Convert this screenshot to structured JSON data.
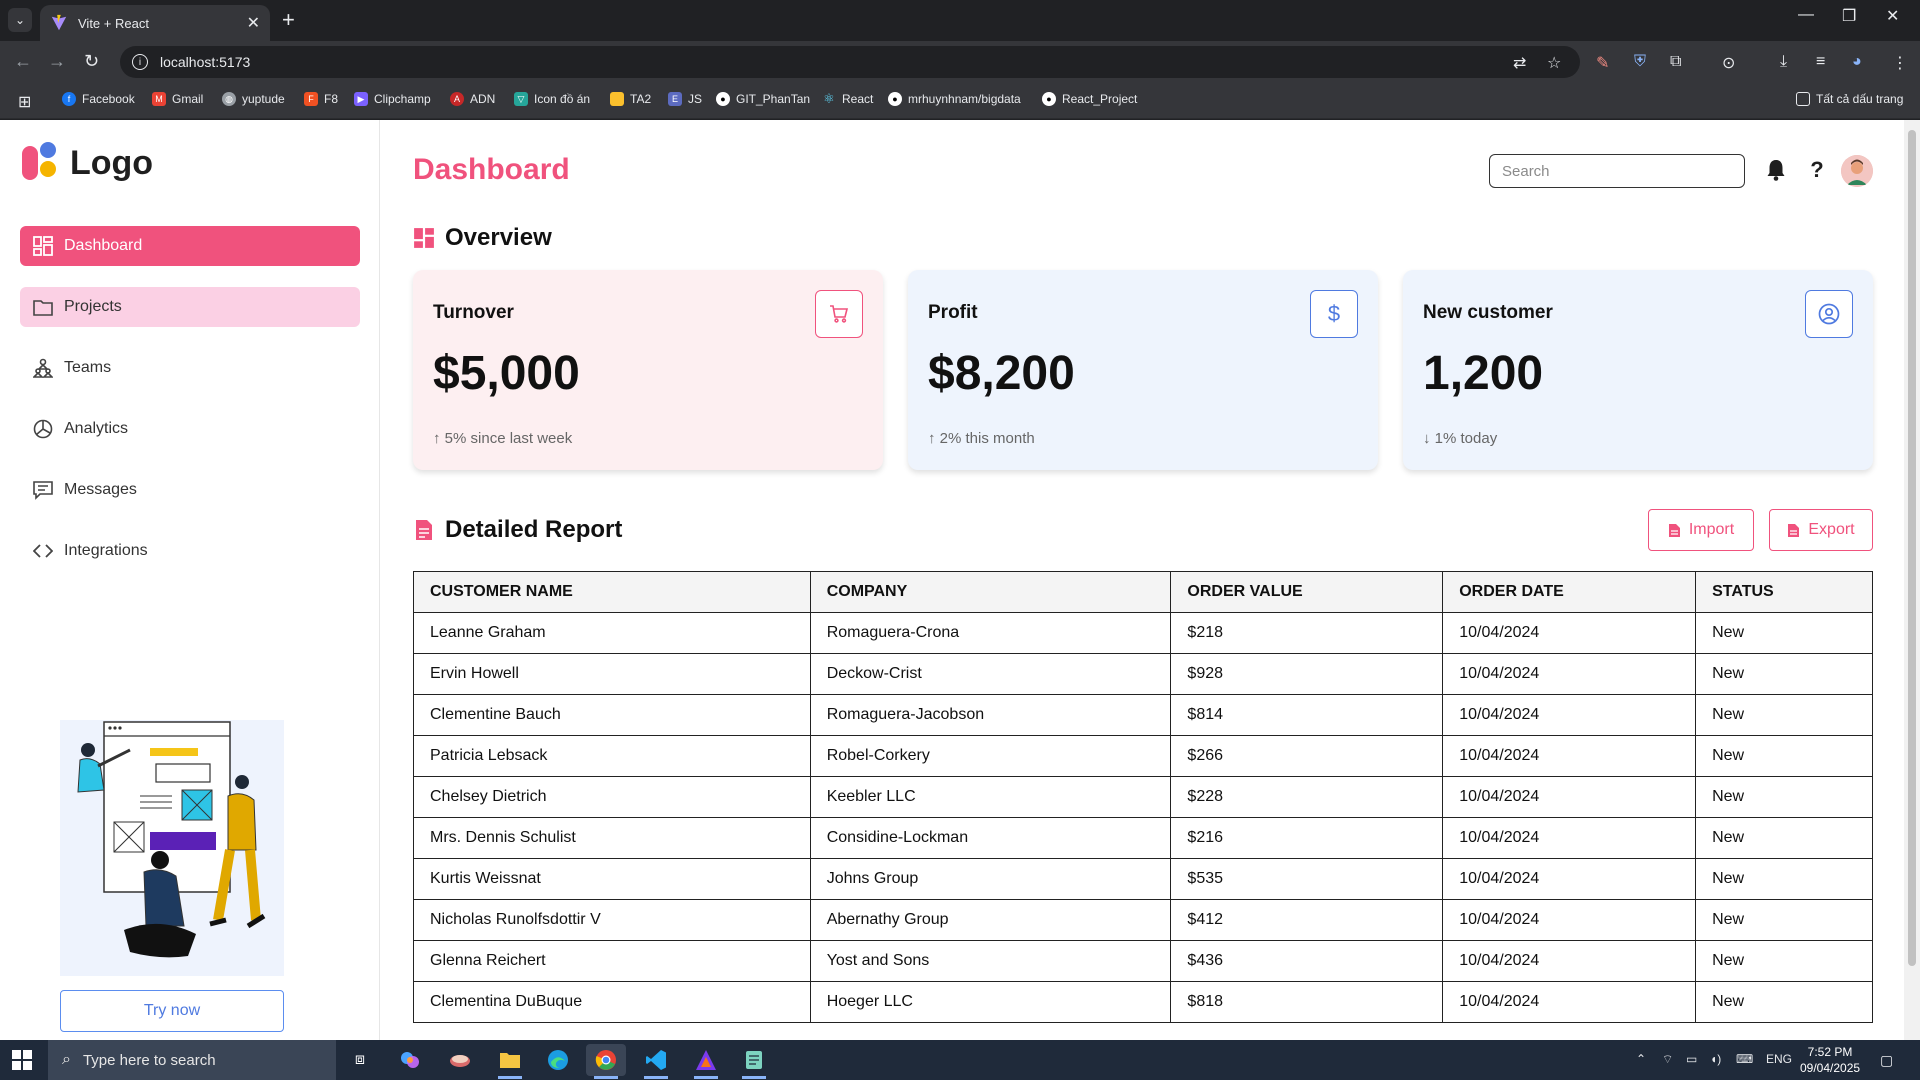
{
  "browser": {
    "tab_title": "Vite + React",
    "url": "localhost:5173",
    "bookmarks": [
      "Facebook",
      "Gmail",
      "yuptude",
      "F8",
      "Clipchamp",
      "ADN",
      "Icon đồ án",
      "TA2",
      "JS",
      "GIT_PhanTan",
      "React",
      "mrhuynhnam/bigdata",
      "React_Project"
    ],
    "all_bookmarks": "Tất cả dấu trang"
  },
  "sidebar": {
    "logo_text": "Logo",
    "items": [
      {
        "label": "Dashboard",
        "icon": "grid-icon"
      },
      {
        "label": "Projects",
        "icon": "folder-icon"
      },
      {
        "label": "Teams",
        "icon": "people-icon"
      },
      {
        "label": "Analytics",
        "icon": "pie-chart-icon"
      },
      {
        "label": "Messages",
        "icon": "message-icon"
      },
      {
        "label": "Integrations",
        "icon": "code-icon"
      }
    ],
    "try_button": "Try now"
  },
  "header": {
    "title": "Dashboard",
    "search_placeholder": "Search"
  },
  "overview": {
    "title": "Overview",
    "cards": [
      {
        "title": "Turnover",
        "value": "$5,000",
        "note": "↑ 5% since last week",
        "icon": "cart-icon",
        "bg": "#fdeff1",
        "accent": "#f0527d"
      },
      {
        "title": "Profit",
        "value": "$8,200",
        "note": "↑ 2% this month",
        "icon": "dollar-icon",
        "bg": "#eef4fd",
        "accent": "#4f7ae0"
      },
      {
        "title": "New customer",
        "value": "1,200",
        "note": "↓ 1% today",
        "icon": "user-circle-icon",
        "bg": "#eef4fd",
        "accent": "#4f7ae0"
      }
    ]
  },
  "report": {
    "title": "Detailed Report",
    "import_label": "Import",
    "export_label": "Export",
    "columns": [
      "CUSTOMER NAME",
      "COMPANY",
      "ORDER VALUE",
      "ORDER DATE",
      "STATUS"
    ],
    "rows": [
      [
        "Leanne Graham",
        "Romaguera-Crona",
        "$218",
        "10/04/2024",
        "New"
      ],
      [
        "Ervin Howell",
        "Deckow-Crist",
        "$928",
        "10/04/2024",
        "New"
      ],
      [
        "Clementine Bauch",
        "Romaguera-Jacobson",
        "$814",
        "10/04/2024",
        "New"
      ],
      [
        "Patricia Lebsack",
        "Robel-Corkery",
        "$266",
        "10/04/2024",
        "New"
      ],
      [
        "Chelsey Dietrich",
        "Keebler LLC",
        "$228",
        "10/04/2024",
        "New"
      ],
      [
        "Mrs. Dennis Schulist",
        "Considine-Lockman",
        "$216",
        "10/04/2024",
        "New"
      ],
      [
        "Kurtis Weissnat",
        "Johns Group",
        "$535",
        "10/04/2024",
        "New"
      ],
      [
        "Nicholas Runolfsdottir V",
        "Abernathy Group",
        "$412",
        "10/04/2024",
        "New"
      ],
      [
        "Glenna Reichert",
        "Yost and Sons",
        "$436",
        "10/04/2024",
        "New"
      ],
      [
        "Clementina DuBuque",
        "Hoeger LLC",
        "$818",
        "10/04/2024",
        "New"
      ]
    ]
  },
  "taskbar": {
    "search_placeholder": "Type here to search",
    "lang": "ENG",
    "time": "7:52 PM",
    "date": "09/04/2025"
  },
  "colors": {
    "brand": "#f0527d",
    "active_item": "#f0527d",
    "hover_item": "#fbd0e4",
    "blue_accent": "#4f7ae0"
  }
}
